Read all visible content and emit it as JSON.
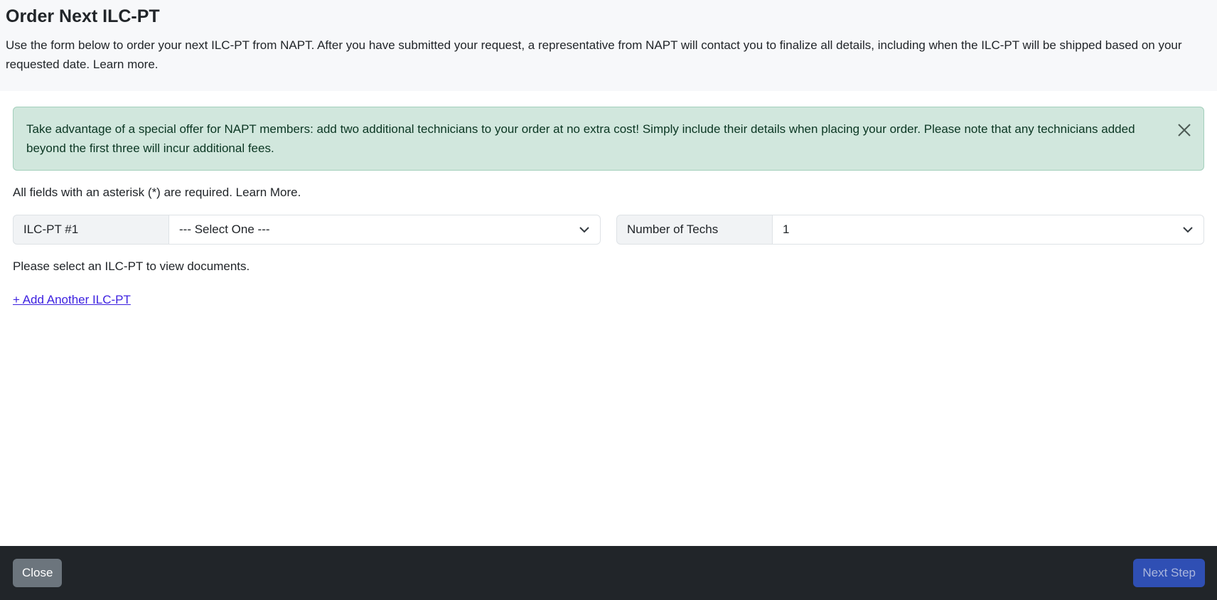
{
  "header": {
    "title": "Order Next ILC-PT",
    "intro": "Use the form below to order your next ILC-PT from NAPT. After you have submitted your request, a representative from NAPT will contact you to finalize all details, including when the ILC-PT will be shipped based on your requested date. Learn more."
  },
  "alert": {
    "text": "Take advantage of a special offer for NAPT members: add two additional technicians to your order at no extra cost! Simply include their details when placing your order. Please note that any technicians added beyond the first three will incur additional fees.",
    "close_icon": "close-icon",
    "color": "#d1e7dd"
  },
  "form": {
    "required_note": "All fields with an asterisk (*) are required. Learn More.",
    "ilc_label": "ILC-PT #1",
    "ilc_value": "--- Select One ---",
    "techs_label": "Number of Techs",
    "techs_value": "1",
    "docs_note": "Please select an ILC-PT to view documents.",
    "add_link": "+ Add Another ILC-PT"
  },
  "footer": {
    "close_label": "Close",
    "next_label": "Next Step"
  }
}
